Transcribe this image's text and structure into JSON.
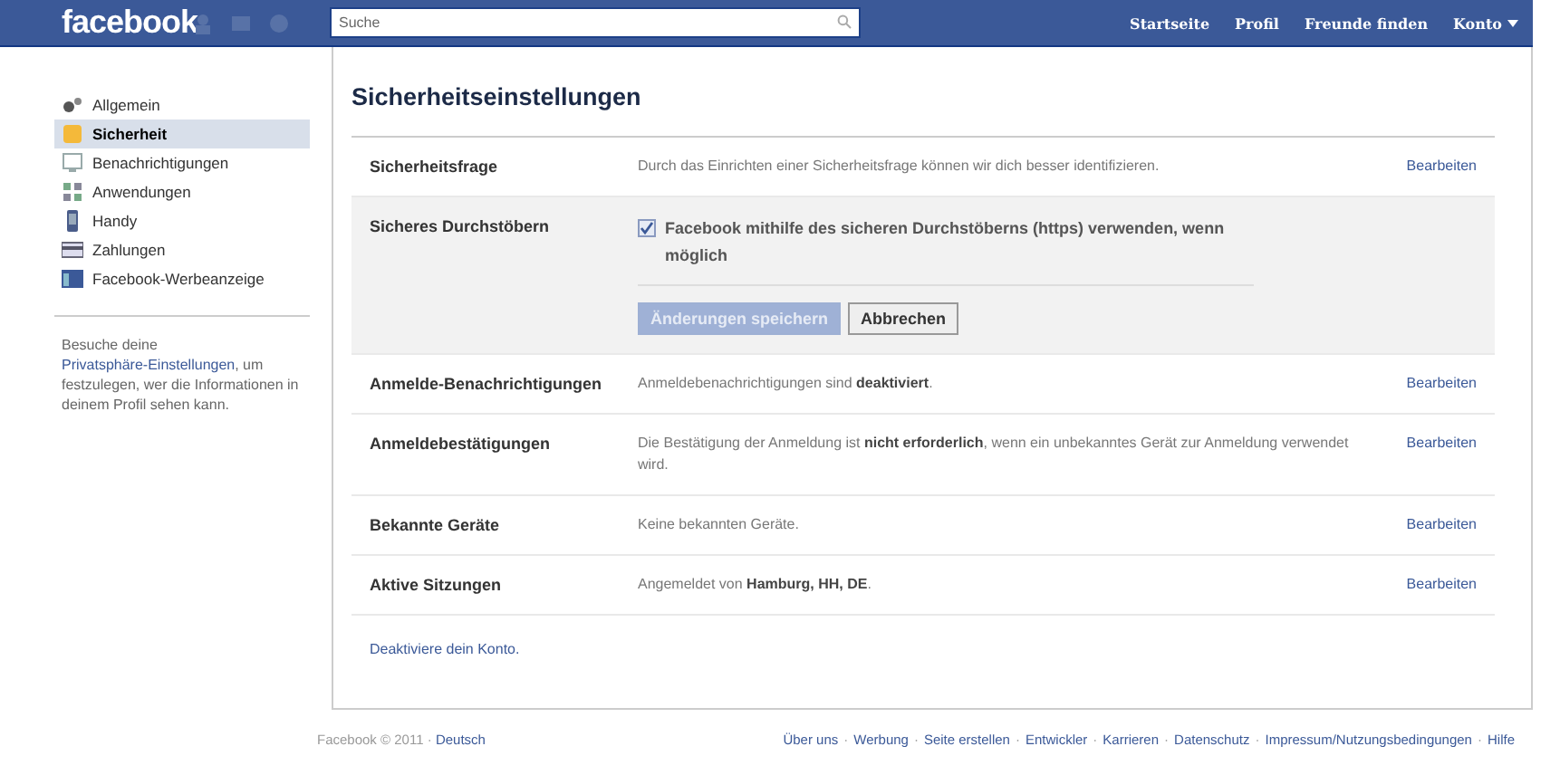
{
  "topbar": {
    "logo": "facebook",
    "search": {
      "placeholder": "Suche"
    },
    "nav": [
      {
        "label": "Startseite"
      },
      {
        "label": "Profil"
      },
      {
        "label": "Freunde finden"
      },
      {
        "label": "Konto",
        "menu": true
      }
    ]
  },
  "sidebar": {
    "items": [
      {
        "label": "Allgemein",
        "selected": false
      },
      {
        "label": "Sicherheit",
        "selected": true
      },
      {
        "label": "Benachrichtigungen",
        "selected": false
      },
      {
        "label": "Anwendungen",
        "selected": false
      },
      {
        "label": "Handy",
        "selected": false
      },
      {
        "label": "Zahlungen",
        "selected": false
      },
      {
        "label": "Facebook-Werbeanzeige",
        "selected": false
      }
    ],
    "note": {
      "before": "Besuche deine",
      "link": "Privatsphäre-Einstellungen",
      "after": ", um festzulegen, wer die Informationen in deinem Profil sehen kann."
    }
  },
  "main": {
    "title": "Sicherheitseinstellungen",
    "rows": [
      {
        "kind": "setting",
        "label": "Sicherheitsfrage",
        "description": "Durch das Einrichten einer Sicherheitsfrage können wir dich besser identifizieren.",
        "action": "Bearbeiten"
      },
      {
        "kind": "expanded",
        "label": "Sicheres Durchstöbern",
        "option": {
          "label": "Facebook mithilfe des sicheren Durchstöberns (https) verwenden, wenn möglich",
          "checked": true
        },
        "buttons": [
          {
            "label": "Änderungen speichern",
            "disabled": true
          },
          {
            "label": "Abbrechen",
            "disabled": false
          }
        ]
      },
      {
        "kind": "setting",
        "label": "Anmelde-Benachrichtigungen",
        "description": "Anmeldebenachrichtigungen sind **deaktiviert**.",
        "action": "Bearbeiten"
      },
      {
        "kind": "setting",
        "label": "Anmeldebestätigungen",
        "description": "Die Bestätigung der Anmeldung ist **nicht erforderlich**, wenn ein unbekanntes Gerät zur Anmeldung verwendet wird.",
        "action": "Bearbeiten"
      },
      {
        "kind": "setting",
        "label": "Bekannte Geräte",
        "description": "Keine bekannten Geräte.",
        "action": "Bearbeiten"
      },
      {
        "kind": "setting",
        "label": "Aktive Sitzungen",
        "description": "Angemeldet von **Hamburg, HH, DE**.",
        "action": "Bearbeiten"
      }
    ],
    "deactivate": "Deaktiviere dein Konto."
  },
  "footer": {
    "separator": "·",
    "copyright": "Facebook © 2011",
    "language": "Deutsch",
    "links": [
      "Über uns",
      "Werbung",
      "Seite erstellen",
      "Entwickler",
      "Karrieren",
      "Datenschutz",
      "Impressum/Nutzungsbedingungen",
      "Hilfe"
    ]
  }
}
